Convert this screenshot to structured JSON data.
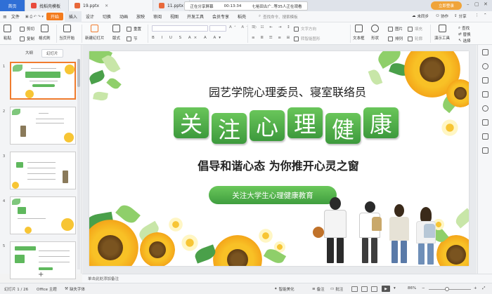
{
  "tabs": [
    {
      "label": "首页",
      "kind": "home"
    },
    {
      "label": "找稻壳模板",
      "icon_color": "#e94b3c"
    },
    {
      "label": "19.pptx",
      "icon_color": "#e8683a"
    },
    {
      "label": "11.pptx",
      "icon_color": "#e8683a"
    }
  ],
  "share_banner": {
    "status": "正在分享屏幕",
    "timer": "00:13:34",
    "viewers": "七裕田古广..等35人正在观看"
  },
  "login_button": "立即登录",
  "menu": {
    "file": "文件",
    "items": [
      "开始",
      "插入",
      "设计",
      "切换",
      "动画",
      "放映",
      "审阅",
      "视图",
      "开发工具",
      "会员专享",
      "稻壳"
    ],
    "search_placeholder": "查找命令、搜索模板",
    "unsynced": "未同步",
    "collab": "协作",
    "share": "分享"
  },
  "ribbon": {
    "paste": "粘贴",
    "cut": "剪切",
    "copy": "复制",
    "format_painter": "格式刷",
    "play_from_current": "当页开始",
    "new_slide": "新建幻灯片",
    "layout": "版式",
    "section": "节",
    "reset": "重置",
    "text_direction": "文字方向",
    "convert_smartart": "转智能图形",
    "textbox": "文本框",
    "shape": "形状",
    "arrange": "排列",
    "picture": "图片",
    "fill": "填充",
    "outline": "轮廓",
    "present_tools": "演示工具",
    "find": "查找",
    "replace": "替换",
    "select": "选择"
  },
  "left_panel": {
    "tab_outline": "大纲",
    "tab_slides": "幻灯片",
    "thumb_numbers": [
      "1",
      "2",
      "3",
      "4",
      "5"
    ]
  },
  "slide": {
    "subtitle": "园艺学院心理委员、寝室联络员",
    "title_chars": [
      "关",
      "注",
      "心",
      "理",
      "健",
      "康"
    ],
    "slogan": "倡导和谐心态  为你推开心灵之窗",
    "pill_text": "关注大学生心理健康教育"
  },
  "notes_placeholder": "单击此处添加备注",
  "status": {
    "slide_info": "幻灯片 1 / 26",
    "theme": "Office 主题",
    "missing_font": "缺失字体",
    "smart_beautify": "智能美化",
    "notes": "备注",
    "comments": "批注",
    "zoom": "86%",
    "zoom_level": 0.86
  },
  "colors": {
    "accent_orange": "#f37b1d",
    "title_green": "#4aa84a",
    "home_blue": "#2f6fd6"
  }
}
